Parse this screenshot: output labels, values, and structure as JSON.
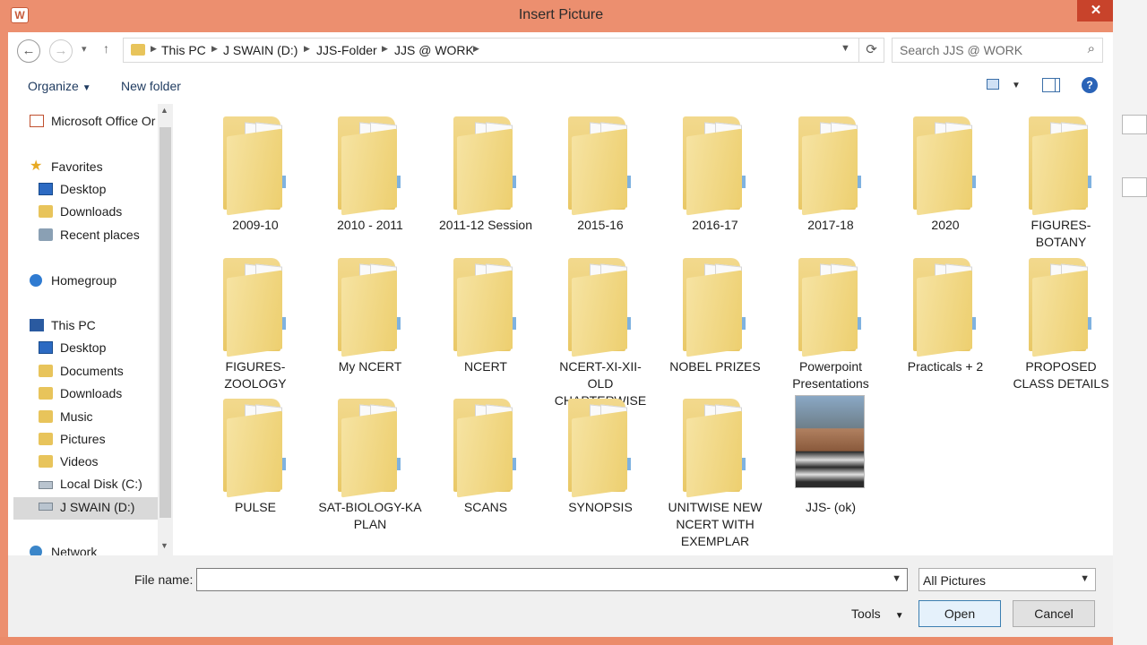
{
  "window": {
    "title": "Insert Picture",
    "close": "✕",
    "app_icon": "word-icon"
  },
  "nav": {
    "back": "←",
    "forward": "→",
    "recent": "▾",
    "up": "↑",
    "breadcrumb": [
      "This PC",
      "J SWAIN (D:)",
      "JJS-Folder",
      "JJS @ WORK"
    ],
    "search_placeholder": "Search JJS @ WORK"
  },
  "toolbar": {
    "organize": "Organize",
    "new_folder": "New folder"
  },
  "sidebar": [
    {
      "label": "Microsoft Office Or",
      "icon": "office-icon"
    },
    {
      "label": "Favorites",
      "icon": "star-icon"
    },
    {
      "label": "Desktop",
      "icon": "desktop-icon"
    },
    {
      "label": "Downloads",
      "icon": "folder-icon"
    },
    {
      "label": "Recent places",
      "icon": "recent-icon"
    },
    {
      "label": "Homegroup",
      "icon": "homegroup-icon"
    },
    {
      "label": "This PC",
      "icon": "pc-icon"
    },
    {
      "label": "Desktop",
      "icon": "desktop-icon"
    },
    {
      "label": "Documents",
      "icon": "folder-icon"
    },
    {
      "label": "Downloads",
      "icon": "folder-icon"
    },
    {
      "label": "Music",
      "icon": "folder-icon"
    },
    {
      "label": "Pictures",
      "icon": "folder-icon"
    },
    {
      "label": "Videos",
      "icon": "folder-icon"
    },
    {
      "label": "Local Disk (C:)",
      "icon": "drive-icon"
    },
    {
      "label": "J SWAIN (D:)",
      "icon": "drive-icon",
      "selected": true
    },
    {
      "label": "Network",
      "icon": "network-icon"
    }
  ],
  "items": [
    {
      "name": "2009-10",
      "type": "folder"
    },
    {
      "name": "2010 - 2011",
      "type": "folder"
    },
    {
      "name": "2011-12 Session",
      "type": "folder"
    },
    {
      "name": "2015-16",
      "type": "folder"
    },
    {
      "name": "2016-17",
      "type": "folder"
    },
    {
      "name": "2017-18",
      "type": "folder"
    },
    {
      "name": "2020",
      "type": "folder"
    },
    {
      "name": "FIGURES-BOTANY",
      "type": "folder"
    },
    {
      "name": "FIGURES-ZOOLOGY",
      "type": "folder"
    },
    {
      "name": "My NCERT",
      "type": "folder"
    },
    {
      "name": "NCERT",
      "type": "folder"
    },
    {
      "name": "NCERT-XI-XII-OLD CHAPTERWISE",
      "type": "folder"
    },
    {
      "name": "NOBEL PRIZES",
      "type": "folder"
    },
    {
      "name": "Powerpoint Presentations",
      "type": "folder"
    },
    {
      "name": "Practicals + 2",
      "type": "folder"
    },
    {
      "name": "PROPOSED CLASS DETAILS",
      "type": "folder"
    },
    {
      "name": "PULSE",
      "type": "folder"
    },
    {
      "name": "SAT-BIOLOGY-KA PLAN",
      "type": "folder"
    },
    {
      "name": "SCANS",
      "type": "folder"
    },
    {
      "name": "SYNOPSIS",
      "type": "folder"
    },
    {
      "name": "UNITWISE NEW NCERT WITH EXEMPLAR",
      "type": "folder"
    },
    {
      "name": "JJS- (ok)",
      "type": "image"
    }
  ],
  "bottom": {
    "file_name_label": "File name:",
    "file_name_value": "",
    "filter": "All Pictures",
    "tools": "Tools",
    "open": "Open",
    "cancel": "Cancel"
  }
}
